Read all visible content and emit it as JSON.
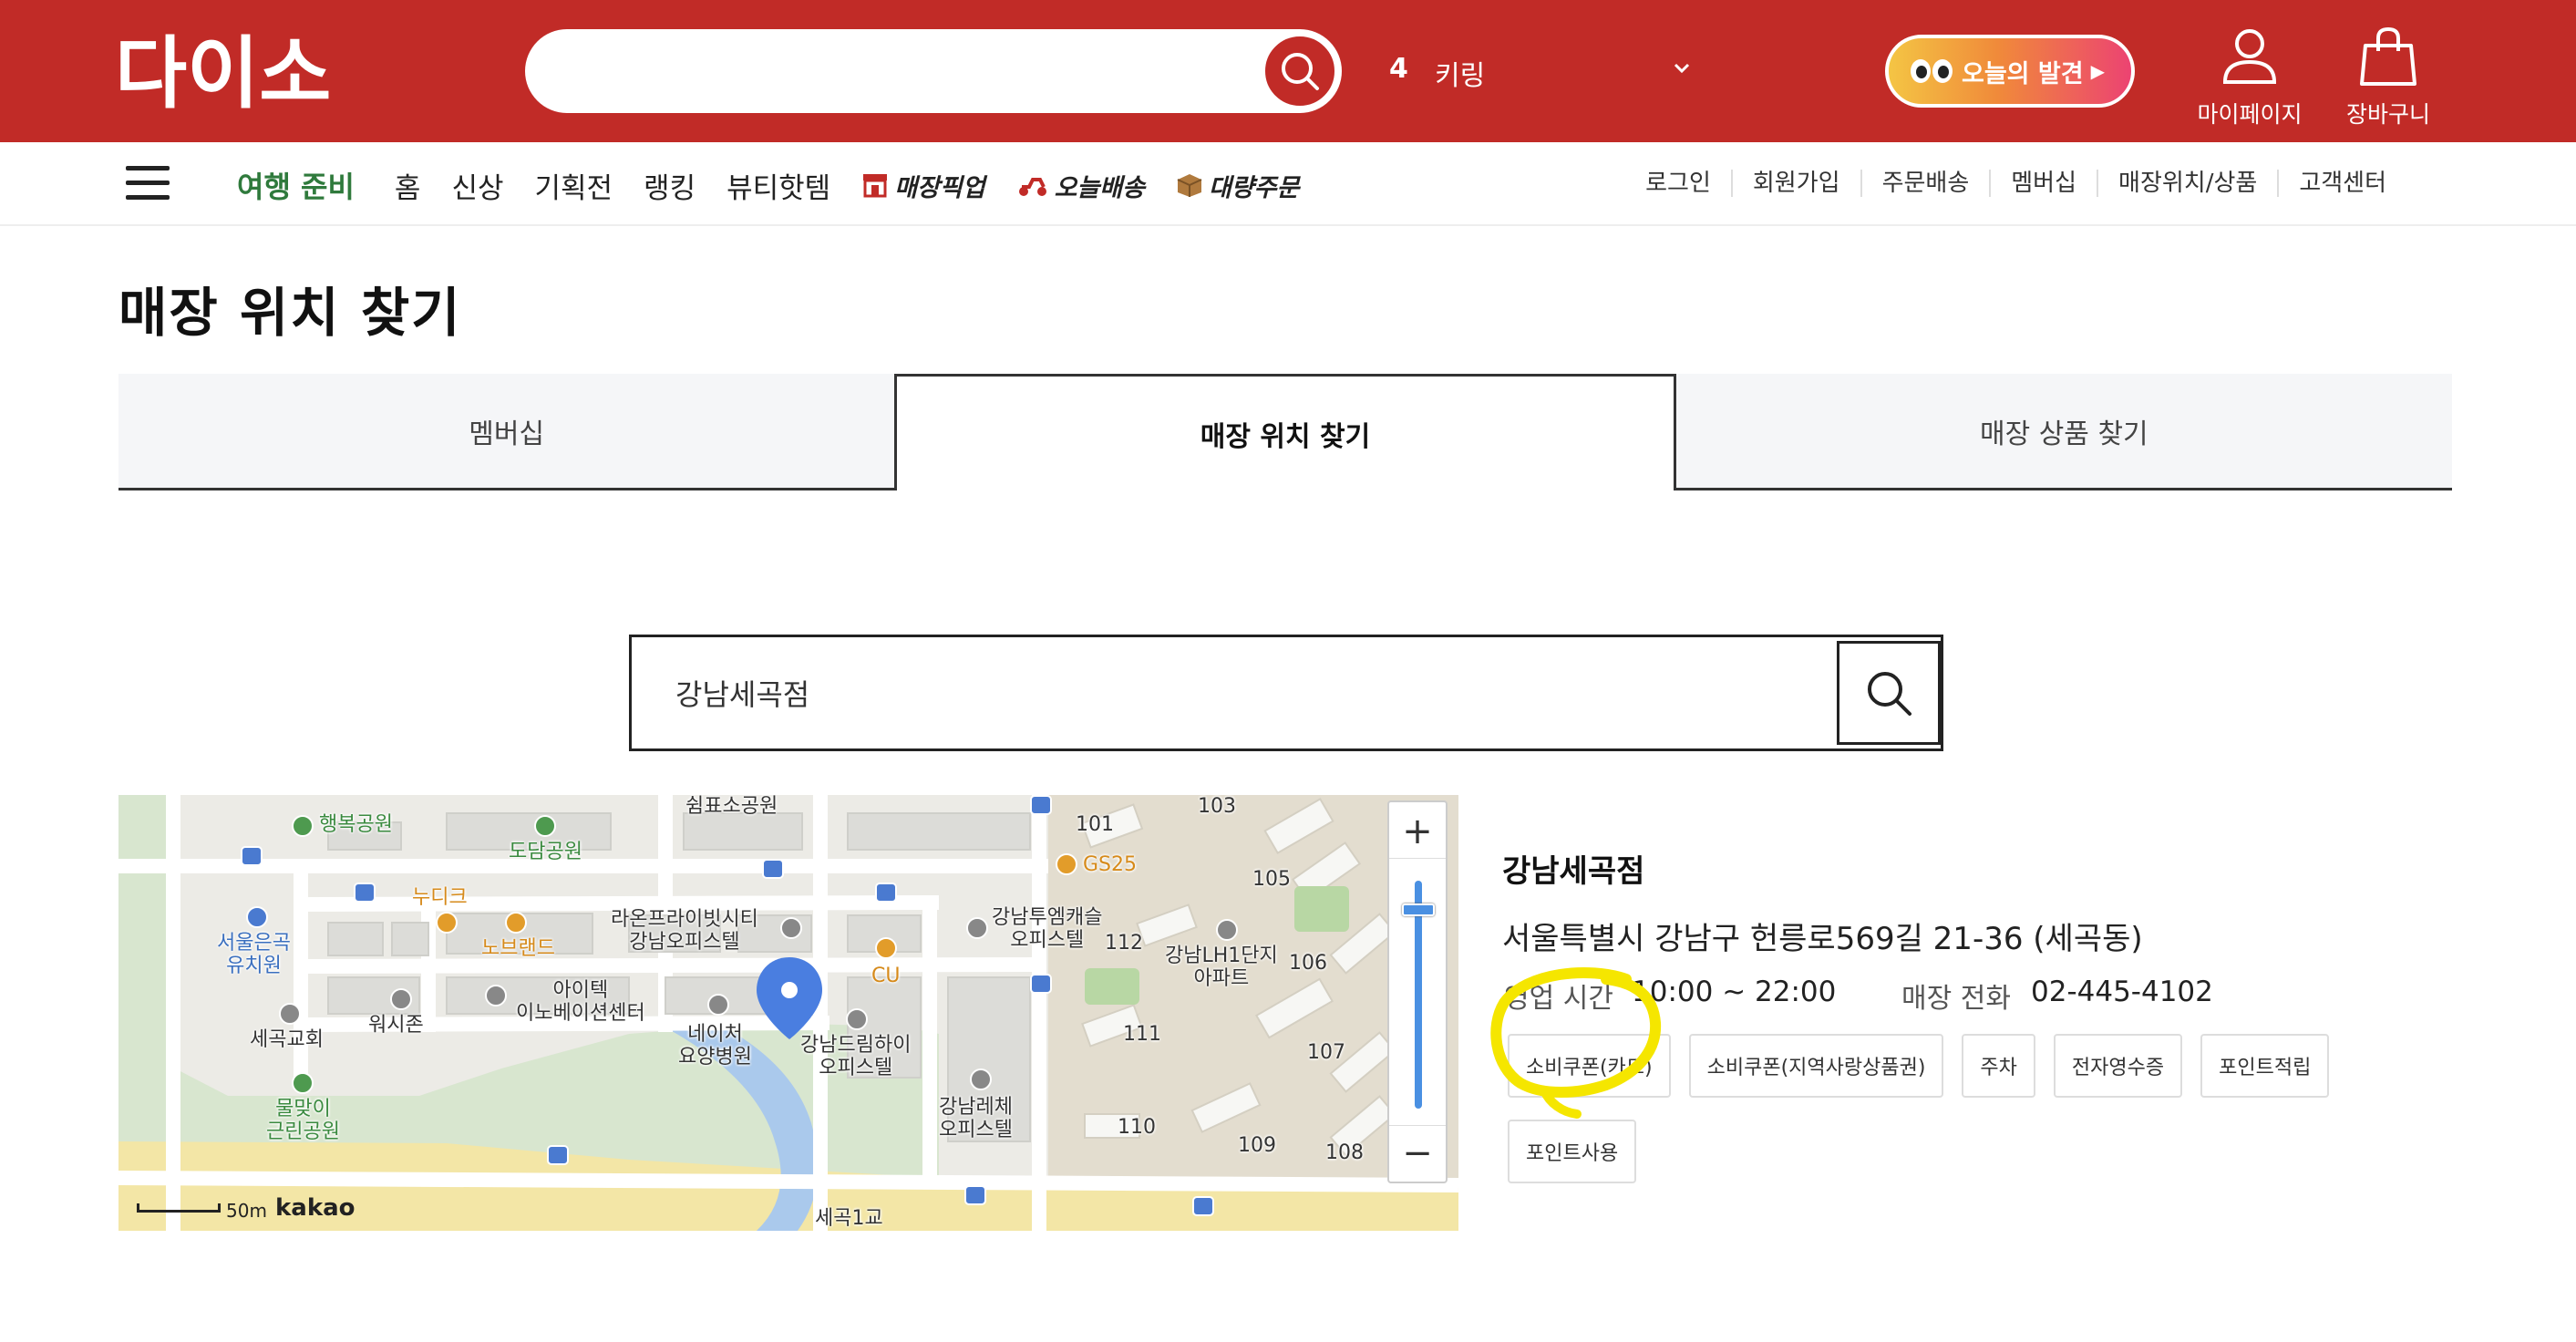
{
  "header": {
    "logo_text": "다이소",
    "search_placeholder": "",
    "trending_rank": "4",
    "trending_keyword": "키링",
    "discover_label": "오늘의 발견",
    "mypage_label": "마이페이지",
    "cart_label": "장바구니"
  },
  "nav": {
    "promo": "여행 준비",
    "items": [
      "홈",
      "신상",
      "기획전",
      "랭킹",
      "뷰티핫템"
    ],
    "specials": [
      "매장픽업",
      "오늘배송",
      "대량주문"
    ],
    "utility": [
      "로그인",
      "회원가입",
      "주문배송",
      "멤버십",
      "매장위치/상품",
      "고객센터"
    ]
  },
  "page": {
    "title": "매장 위치 찾기",
    "tabs": [
      "멤버십",
      "매장 위치 찾기",
      "매장 상품 찾기"
    ],
    "active_tab": 1
  },
  "store_search": {
    "value": "강남세곡점"
  },
  "map": {
    "labels": {
      "park1": "행복공원",
      "park2": "도담공원",
      "sign": "쉼표소공원",
      "nudi": "누디크",
      "nobrand": "노브랜드",
      "kinder": "서울은곡\n유치원",
      "laon": "라온프라이빗시티\n강남오피스텔",
      "gs25": "GS25",
      "cu": "CU",
      "twinm": "강남투엠캐슬\n오피스텔",
      "lh": "강남LH1단지\n아파트",
      "itech": "아이텍\n이노베이션센터",
      "wash": "워시존",
      "church": "세곡교회",
      "nature": "네이처\n요양병원",
      "dream": "강남드림하이\n오피스텔",
      "lache": "강남레체\n오피스텔",
      "mulmaji": "물맞이\n근린공원",
      "bridge": "세곡1교",
      "apt101": "101",
      "apt103": "103",
      "apt105": "105",
      "apt106": "106",
      "apt107": "107",
      "apt108": "108",
      "apt109": "109",
      "apt110": "110",
      "apt111": "111",
      "apt112": "112"
    },
    "scale": "50m",
    "brand": "kakao",
    "zoom_in": "+",
    "zoom_out": "−",
    "zoom_level": 0.1
  },
  "store": {
    "name": "강남세곡점",
    "address": "서울특별시 강남구 헌릉로569길 21-36 (세곡동)",
    "hours_label": "영업 시간",
    "hours": "10:00 ~ 22:00",
    "tel_label": "매장 전화",
    "tel": "02-445-4102",
    "services": [
      "소비쿠폰(카드)",
      "소비쿠폰(지역사랑상품권)",
      "주차",
      "전자영수증",
      "포인트적립",
      "포인트사용"
    ]
  },
  "colors": {
    "brand_red": "#c12b27",
    "promo_green": "#2f7a3c",
    "highlight_yellow": "#f5e600"
  }
}
